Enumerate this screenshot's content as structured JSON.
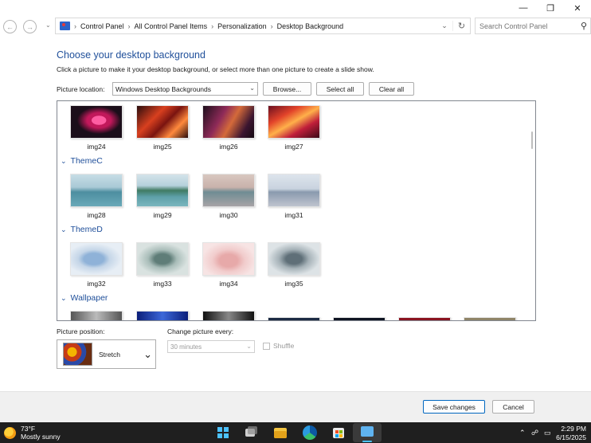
{
  "window": {
    "minimize_icon": "minimize-icon",
    "maximize_icon": "restore-icon",
    "close_icon": "close-icon"
  },
  "address": {
    "crumbs": [
      "Control Panel",
      "All Control Panel Items",
      "Personalization",
      "Desktop Background"
    ]
  },
  "search": {
    "placeholder": "Search Control Panel"
  },
  "page": {
    "title": "Choose your desktop background",
    "subtitle": "Click a picture to make it your desktop background, or select more than one picture to create a slide show."
  },
  "location": {
    "label": "Picture location:",
    "value": "Windows Desktop Backgrounds",
    "browse": "Browse...",
    "select_all": "Select all",
    "clear_all": "Clear all"
  },
  "gallery": {
    "rows": [
      {
        "images": [
          "img24",
          "img25",
          "img26",
          "img27"
        ]
      },
      {
        "group": "ThemeC",
        "images": [
          "img28",
          "img29",
          "img30",
          "img31"
        ]
      },
      {
        "group": "ThemeD",
        "images": [
          "img32",
          "img33",
          "img34",
          "img35"
        ]
      },
      {
        "group": "Wallpaper",
        "images": []
      }
    ]
  },
  "position": {
    "label": "Picture position:",
    "value": "Stretch"
  },
  "change": {
    "label": "Change picture every:",
    "value": "30 minutes",
    "shuffle": "Shuffle"
  },
  "footer": {
    "save": "Save changes",
    "cancel": "Cancel"
  },
  "taskbar": {
    "temperature": "73°F",
    "condition": "Mostly sunny",
    "time": "2:29 PM",
    "date": "6/15/2025"
  },
  "colors": {
    "accent": "#1f4f9a",
    "taskbar": "#1f1f1f",
    "save_border": "#0067c0"
  }
}
